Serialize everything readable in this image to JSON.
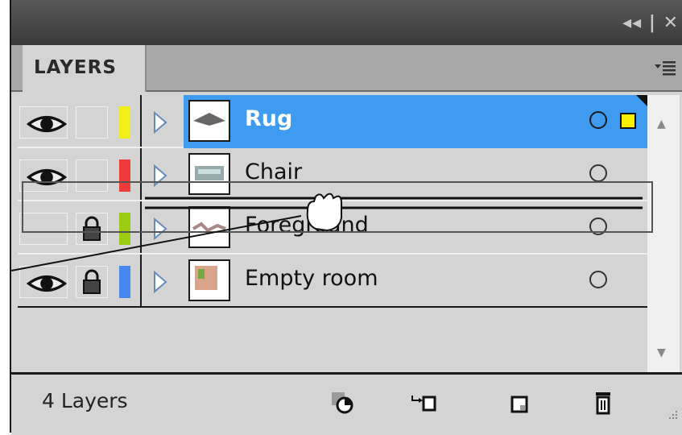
{
  "panel": {
    "title_controls": "◂◂ | ✕",
    "tab_label": "LAYERS",
    "menu_icon": "panel-menu-icon"
  },
  "layers": [
    {
      "name": "Rug",
      "visible": true,
      "locked": false,
      "color": "#f2ee1a",
      "selected": true
    },
    {
      "name": "Chair",
      "visible": true,
      "locked": false,
      "color": "#ee3a3a",
      "selected": false
    },
    {
      "name": "Foreground",
      "visible": false,
      "locked": true,
      "color": "#9ccc12",
      "selected": false
    },
    {
      "name": "Empty room",
      "visible": true,
      "locked": true,
      "color": "#4a86f0",
      "selected": false
    }
  ],
  "footer": {
    "count_label": "4 Layers",
    "buttons": [
      "make-clipping-mask-icon",
      "create-new-sublayer-icon",
      "create-new-layer-icon",
      "delete-layer-icon"
    ]
  },
  "colors": {
    "selection_blue": "#3e9bf0",
    "selection_indicator": "#f7f000"
  }
}
